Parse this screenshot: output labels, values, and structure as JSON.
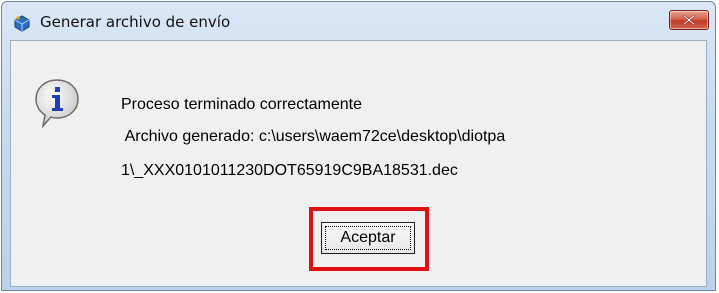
{
  "window": {
    "title": "Generar archivo de envío",
    "icon": "java-cup-icon",
    "close_icon": "close-x-icon"
  },
  "message": {
    "icon": "info-icon",
    "line1": "Proceso terminado correctamente",
    "line2": " Archivo generado: c:\\users\\waem72ce\\desktop\\diotpa",
    "line3": "1\\_XXX0101011230DOT65919C9BA18531.dec"
  },
  "buttons": {
    "accept_label": "Aceptar"
  },
  "colors": {
    "highlight": "#e01010",
    "close_button": "#c8452f",
    "titlebar": "#c9dbef"
  }
}
